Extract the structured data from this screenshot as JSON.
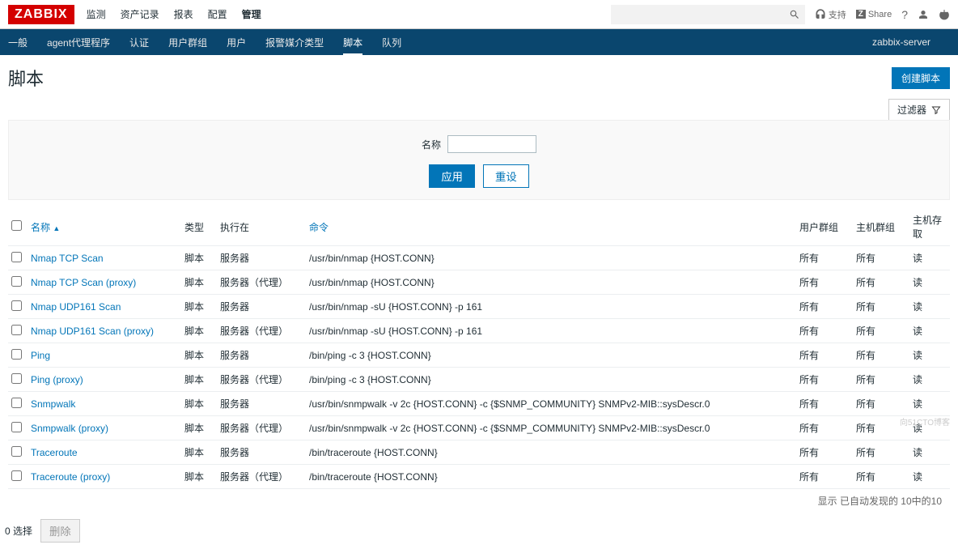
{
  "brand": "ZABBIX",
  "main_nav": [
    "监测",
    "资产记录",
    "报表",
    "配置",
    "管理"
  ],
  "main_nav_active": 4,
  "top_right": {
    "support": "支持",
    "share": "Share"
  },
  "sub_nav": [
    "一般",
    "agent代理程序",
    "认证",
    "用户群组",
    "用户",
    "报警媒介类型",
    "脚本",
    "队列"
  ],
  "sub_nav_active": 6,
  "server": "zabbix-server",
  "page_title": "脚本",
  "btn_create": "创建脚本",
  "filter_tab": "过滤器",
  "filter": {
    "name_label": "名称",
    "apply": "应用",
    "reset": "重设"
  },
  "columns": {
    "name": "名称",
    "type": "类型",
    "exec": "执行在",
    "cmd": "命令",
    "ug": "用户群组",
    "hg": "主机群组",
    "ha": "主机存取"
  },
  "sort_indicator": "▲",
  "rows": [
    {
      "name": "Nmap TCP Scan",
      "type": "脚本",
      "exec": "服务器",
      "cmd": "/usr/bin/nmap {HOST.CONN}",
      "ug": "所有",
      "hg": "所有",
      "ha": "读"
    },
    {
      "name": "Nmap TCP Scan (proxy)",
      "type": "脚本",
      "exec": "服务器（代理）",
      "cmd": "/usr/bin/nmap {HOST.CONN}",
      "ug": "所有",
      "hg": "所有",
      "ha": "读"
    },
    {
      "name": "Nmap UDP161 Scan",
      "type": "脚本",
      "exec": "服务器",
      "cmd": "/usr/bin/nmap -sU {HOST.CONN} -p 161",
      "ug": "所有",
      "hg": "所有",
      "ha": "读"
    },
    {
      "name": "Nmap UDP161 Scan (proxy)",
      "type": "脚本",
      "exec": "服务器（代理）",
      "cmd": "/usr/bin/nmap -sU {HOST.CONN} -p 161",
      "ug": "所有",
      "hg": "所有",
      "ha": "读"
    },
    {
      "name": "Ping",
      "type": "脚本",
      "exec": "服务器",
      "cmd": "/bin/ping -c 3 {HOST.CONN}",
      "ug": "所有",
      "hg": "所有",
      "ha": "读"
    },
    {
      "name": "Ping (proxy)",
      "type": "脚本",
      "exec": "服务器（代理）",
      "cmd": "/bin/ping -c 3 {HOST.CONN}",
      "ug": "所有",
      "hg": "所有",
      "ha": "读"
    },
    {
      "name": "Snmpwalk",
      "type": "脚本",
      "exec": "服务器",
      "cmd": "/usr/bin/snmpwalk -v 2c {HOST.CONN} -c {$SNMP_COMMUNITY} SNMPv2-MIB::sysDescr.0",
      "ug": "所有",
      "hg": "所有",
      "ha": "读"
    },
    {
      "name": "Snmpwalk (proxy)",
      "type": "脚本",
      "exec": "服务器（代理）",
      "cmd": "/usr/bin/snmpwalk -v 2c {HOST.CONN} -c {$SNMP_COMMUNITY} SNMPv2-MIB::sysDescr.0",
      "ug": "所有",
      "hg": "所有",
      "ha": "读"
    },
    {
      "name": "Traceroute",
      "type": "脚本",
      "exec": "服务器",
      "cmd": "/bin/traceroute {HOST.CONN}",
      "ug": "所有",
      "hg": "所有",
      "ha": "读"
    },
    {
      "name": "Traceroute (proxy)",
      "type": "脚本",
      "exec": "服务器（代理）",
      "cmd": "/bin/traceroute {HOST.CONN}",
      "ug": "所有",
      "hg": "所有",
      "ha": "读"
    }
  ],
  "footer_count": "显示 已自动发现的 10中的10",
  "selected_text": "0 选择",
  "delete_btn": "删除",
  "watermark": "向51CTO博客"
}
